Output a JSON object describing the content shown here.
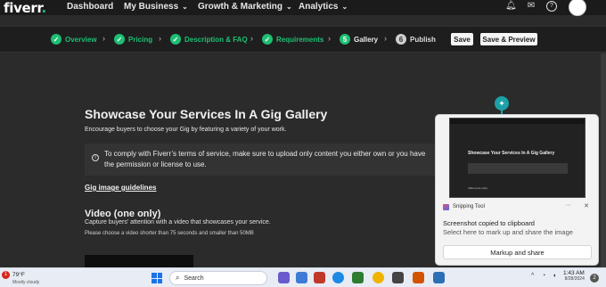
{
  "topnav": {
    "logo": "fiverr",
    "logo_dot": ".",
    "links": [
      "Dashboard",
      "My Business",
      "Growth & Marketing",
      "Analytics"
    ],
    "icons": [
      "bell-icon",
      "mail-icon",
      "help-icon"
    ]
  },
  "wizard": {
    "steps": [
      {
        "num": "✓",
        "label": "Overview",
        "state": "done"
      },
      {
        "num": "✓",
        "label": "Pricing",
        "state": "done"
      },
      {
        "num": "✓",
        "label": "Description & FAQ",
        "state": "done"
      },
      {
        "num": "✓",
        "label": "Requirements",
        "state": "done"
      },
      {
        "num": "5",
        "label": "Gallery",
        "state": "active"
      },
      {
        "num": "6",
        "label": "Publish",
        "state": "pending"
      }
    ],
    "save_label": "Save",
    "save_preview_label": "Save & Preview"
  },
  "main": {
    "title": "Showcase Your Services In A Gig Gallery",
    "subtitle": "Encourage buyers to choose your Gig by featuring a variety of your work.",
    "notice": "To comply with Fiverr’s terms of service, make sure to upload only content you either own or you have the permission or license to use.",
    "guidelines_link": "Gig image guidelines",
    "video_title": "Video (one only)",
    "video_sub": "Capture buyers’ attention with a video that showcases your service.",
    "video_req": "Please choose a video shorter than 75 seconds and smaller than 50MB"
  },
  "toast": {
    "app_name": "Snipping Tool",
    "more": "···",
    "close": "✕",
    "message": "Screenshot copied to clipboard",
    "hint": "Select here to mark up and share the image",
    "button": "Markup and share",
    "thumb_title": "Showcase Your Services In A Gig Gallery",
    "thumb_video": "Video (one only)"
  },
  "taskbar": {
    "weather_badge": "1",
    "temperature": "79°F",
    "weather_sub": "Mostly cloudy",
    "search_placeholder": "Search",
    "time": "1:43 AM",
    "date": "8/28/2024",
    "notification_count": "2",
    "tray": "^"
  },
  "colors": {
    "brand_green": "#1dbf73",
    "background": "#2b2b2b",
    "pin_teal": "#1da1a8"
  }
}
